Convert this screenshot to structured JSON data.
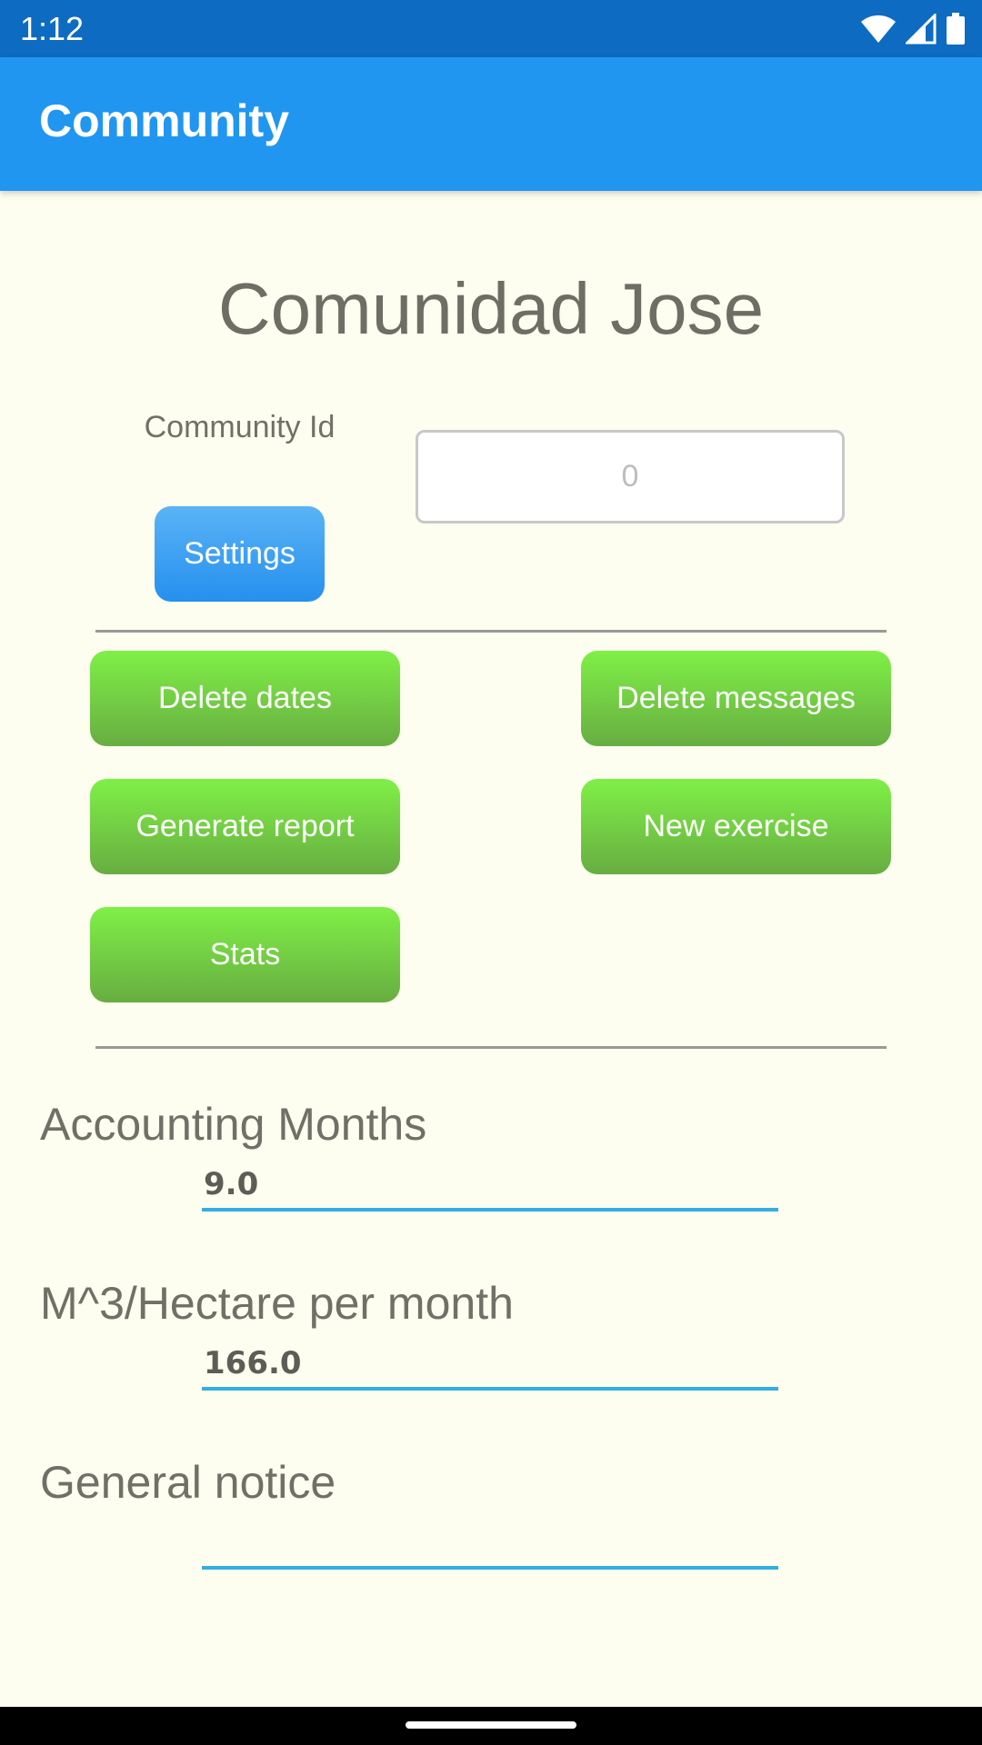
{
  "status_bar": {
    "time": "1:12",
    "icons": [
      "wifi-icon",
      "signal-icon",
      "battery-icon"
    ]
  },
  "app_bar": {
    "title": "Community"
  },
  "community": {
    "name": "Comunidad Jose",
    "id_label": "Community Id",
    "id_placeholder": "0",
    "settings_label": "Settings"
  },
  "actions": {
    "delete_dates": "Delete dates",
    "delete_messages": "Delete messages",
    "generate_report": "Generate report",
    "new_exercise": "New exercise",
    "stats": "Stats"
  },
  "fields": {
    "accounting_months": {
      "label": "Accounting Months",
      "value": "9.0"
    },
    "m3_hectare": {
      "label": "M^3/Hectare per month",
      "value": "166.0"
    },
    "general_notice": {
      "label": "General notice",
      "value": ""
    }
  },
  "colors": {
    "status_bar": "#0d6bc2",
    "app_bar": "#2196f0",
    "background": "#fdfdf0",
    "green_button": "#72cc44",
    "blue_button": "#3aa0f2",
    "input_underline": "#33aee0"
  }
}
